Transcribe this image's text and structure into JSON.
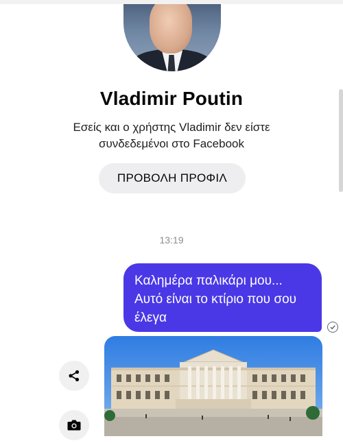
{
  "profile": {
    "name": "Vladimir Poutin",
    "subtitle": "Εσείς και ο χρήστης Vladimir δεν είστε συνδεδεμένοι στο Facebook",
    "view_profile_label": "ΠΡΟΒΟΛΗ ΠΡΟΦΙΛ"
  },
  "conversation": {
    "timestamp": "13:19",
    "messages": [
      {
        "text": "Καλημέρα παλικάρι μου... Αυτό είναι το κτίριο που σου έλεγα",
        "status_icon": "sent-check-icon"
      },
      {
        "type": "photo",
        "subject": "building-photo"
      }
    ]
  },
  "actions": {
    "share_icon": "share-icon",
    "camera_icon": "camera-icon"
  },
  "colors": {
    "bubble": "#4a38e6",
    "button_bg": "#eeeef0",
    "timestamp": "#8a8d91"
  }
}
